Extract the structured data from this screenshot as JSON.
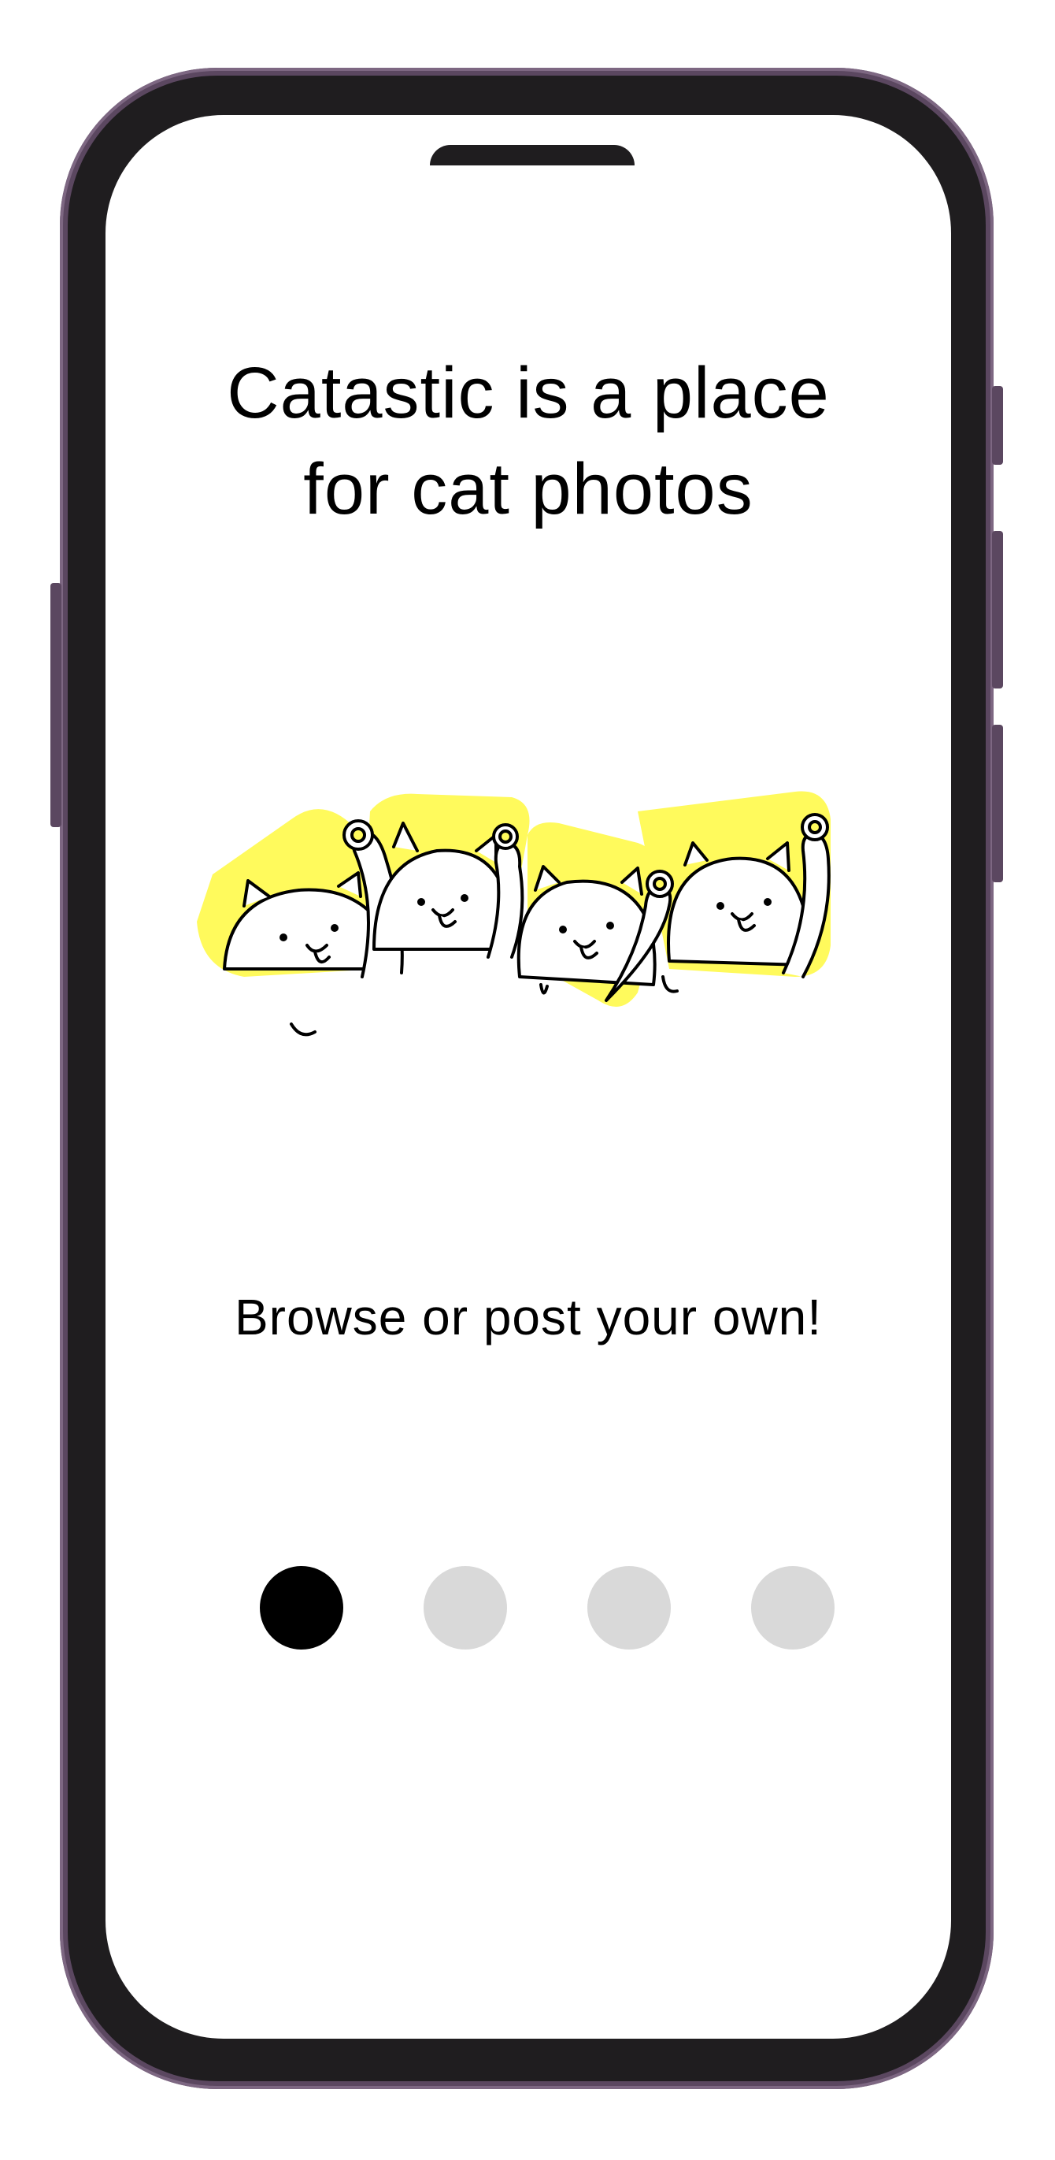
{
  "onboarding": {
    "title_line1": "Catastic is a place",
    "title_line2": "for cat photos",
    "subtitle": "Browse or post your own!",
    "illustration_name": "cats-waving-icon",
    "accent_color": "#fffa5c",
    "page_indicator": {
      "total": 4,
      "current": 1,
      "active_color": "#000000",
      "inactive_color": "#d9d9d9"
    }
  },
  "device": {
    "frame_color": "#5b4760",
    "bezel_color": "#1f1d1f"
  }
}
